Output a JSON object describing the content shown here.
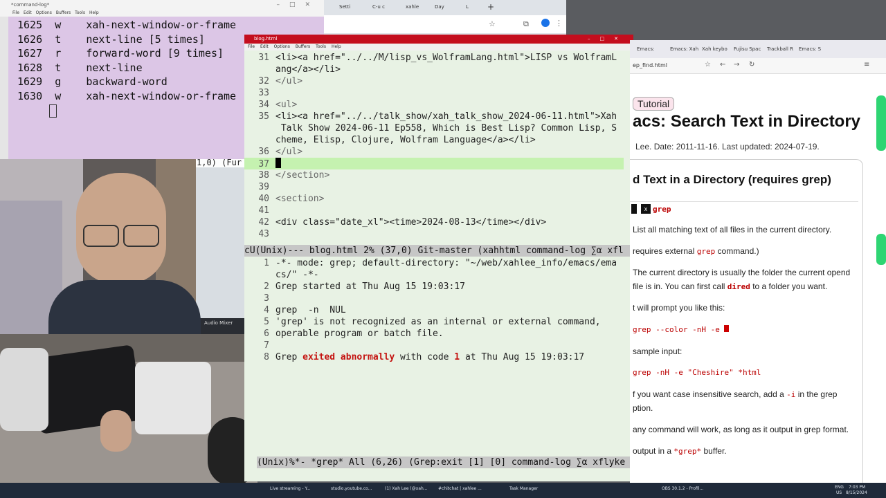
{
  "cmdlog": {
    "title": "*command-log*",
    "menu": [
      "File",
      "Edit",
      "Options",
      "Buffers",
      "Tools",
      "Help"
    ],
    "rows": [
      {
        "n": "1625",
        "k": "w",
        "cmd": "xah-next-window-or-frame"
      },
      {
        "n": "1626",
        "k": "t",
        "cmd": "next-line [5 times]"
      },
      {
        "n": "1627",
        "k": "r",
        "cmd": "forward-word [9 times]"
      },
      {
        "n": "1628",
        "k": "t",
        "cmd": "next-line"
      },
      {
        "n": "1629",
        "k": "g",
        "cmd": "backward-word"
      },
      {
        "n": "1630",
        "k": "w",
        "cmd": "xah-next-window-or-frame"
      }
    ],
    "side_label": "1,0) (Fur"
  },
  "chrome": {
    "tabs": [
      "Setti",
      "C-u c",
      "xahle",
      "Day",
      "L"
    ],
    "new_tab": "+"
  },
  "emacs": {
    "title": "blog.html",
    "menu": [
      "File",
      "Edit",
      "Options",
      "Buffers",
      "Tools",
      "Help"
    ],
    "top_lines": [
      {
        "n": "31",
        "t": "<li><a href=\"../../M/lisp_vs_WolframLang.html\">LISP vs WolframL"
      },
      {
        "n": "",
        "t": "ang</a></li>"
      },
      {
        "n": "32",
        "t": "</ul>"
      },
      {
        "n": "33",
        "t": ""
      },
      {
        "n": "34",
        "t": "<ul>"
      },
      {
        "n": "35",
        "t": "<li><a href=\"../../talk_show/xah_talk_show_2024-06-11.html\">Xah"
      },
      {
        "n": "",
        "t": " Talk Show 2024-06-11 Ep558, Which is Best Lisp? Common Lisp, S"
      },
      {
        "n": "",
        "t": "cheme, Elisp, Clojure, Wolfram Language</a></li>"
      },
      {
        "n": "36",
        "t": "</ul>"
      },
      {
        "n": "37",
        "t": ""
      },
      {
        "n": "38",
        "t": "</section>"
      },
      {
        "n": "39",
        "t": ""
      },
      {
        "n": "40",
        "t": "<section>"
      },
      {
        "n": "41",
        "t": ""
      },
      {
        "n": "42",
        "t": "<div class=\"date_xl\"><time>2024-08-13</time></div>"
      },
      {
        "n": "43",
        "t": ""
      }
    ],
    "modeline_top": "cU(Unix)--- blog.html 2% (37,0) Git-master (xahhtml command-log ∑α xfl",
    "grep_lines": [
      {
        "n": "1",
        "t": "-*- mode: grep; default-directory: \"~/web/xahlee_info/emacs/ema"
      },
      {
        "n": "",
        "t": "cs/\" -*-"
      },
      {
        "n": "2",
        "t": "Grep started at Thu Aug 15 19:03:17"
      },
      {
        "n": "3",
        "t": ""
      },
      {
        "n": "4",
        "t": "grep  -n  NUL"
      },
      {
        "n": "5",
        "t": "'grep' is not recognized as an internal or external command,"
      },
      {
        "n": "6",
        "t": "operable program or batch file."
      },
      {
        "n": "7",
        "t": ""
      }
    ],
    "grep_last": {
      "n": "8",
      "a": "Grep ",
      "b": "exited abnormally",
      "c": " with code ",
      "d": "1",
      "e": " at Thu Aug 15 19:03:17"
    },
    "modeline_bottom": "(Unix)%*- *grep* All (6,26) (Grep:exit [1] [0] command-log ∑α xflyke"
  },
  "browser": {
    "tabs": [
      "Emacs:",
      "Emacs: Xah",
      "Xah keybo",
      "Fujisu Spac",
      "Trackball R",
      "Emacs: S"
    ],
    "url": "ep_find.html",
    "badge": "Tutorial",
    "title": "acs: Search Text in Directory",
    "byline": "Lee. Date: 2011-11-16. Last updated: 2024-07-19.",
    "h2": "d Text in a Directory (requires grep)",
    "key": "grep",
    "p1": "List all matching text of all files in the current directory.",
    "p2a": "requires external ",
    "p2code": "grep",
    "p2b": " command.)",
    "p3a": "The current directory is usually the folder the current opend",
    "p3b": "file is in. You can first call ",
    "p3code": "dired",
    "p3c": " to a folder you want.",
    "p4": "t will prompt you like this:",
    "c1": "grep --color -nH -e",
    "p5": "sample input:",
    "c2": "grep -nH -e \"Cheshire\" *html",
    "p6a": "f you want case insensitive search, add a ",
    "p6code": "-i",
    "p6b": " in the grep",
    "p6c": "ption.",
    "p7": "any command will work, as long as it output in grep format.",
    "p8a": "output in a ",
    "p8code": "*grep*",
    "p8b": " buffer."
  },
  "obs": {
    "mixer": "Audio Mixer"
  },
  "taskbar": {
    "items": [
      "Live streaming - Y...",
      "studio.youtube.co...",
      "(1) Xah Lee (@xah...",
      "#chitchat | xahlee ...",
      "Task Manager",
      "OBS 30.1.2 - Profil..."
    ],
    "lang": "ENG",
    "region": "US",
    "time": "7:03 PM",
    "date": "8/15/2024"
  }
}
